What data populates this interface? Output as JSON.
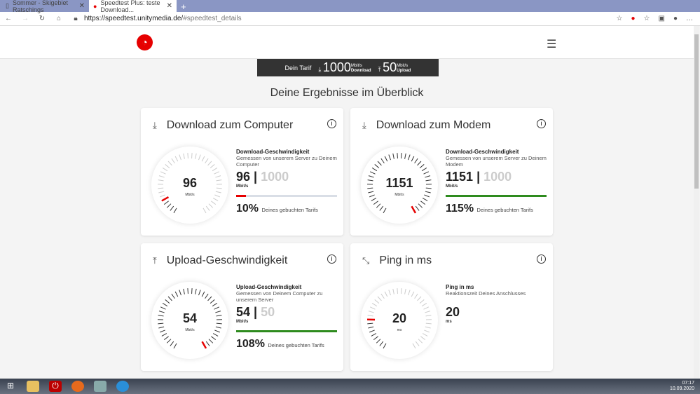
{
  "browser": {
    "tabs": [
      {
        "label": "Sommer - Skigebiet Ratschings"
      },
      {
        "label": "Speedtest Plus: teste Download..."
      }
    ],
    "url_domain": "https://speedtest.unitymedia.de/",
    "url_rest": "#speedtest_details"
  },
  "tarif": {
    "label": "Dein Tarif",
    "download": "1000",
    "download_unit": "Mbit/s",
    "download_label": "Download",
    "upload": "50",
    "upload_unit": "Mbit/s",
    "upload_label": "Upload"
  },
  "title": "Deine Ergebnisse im Überblick",
  "cards": [
    {
      "heading": "Download zum Computer",
      "value": "96",
      "unit": "Mbit/s",
      "label": "Download-Geschwindigkeit",
      "desc": "Gemessen von unserem Server zu Deinem Computer",
      "of": "1000",
      "sep": "|",
      "pct": "10%",
      "pct_text": "Deines gebuchten Tarifs",
      "fraction": 0.096,
      "bar_color": "#e60000"
    },
    {
      "heading": "Download zum Modem",
      "value": "1151",
      "unit": "Mbit/s",
      "label": "Download-Geschwindigkeit",
      "desc": "Gemessen von unserem Server zu Deinem Modem",
      "of": "1000",
      "sep": "|",
      "pct": "115%",
      "pct_text": "Deines gebuchten Tarifs",
      "fraction": 1.0,
      "bar_color": "#2e8b1e"
    },
    {
      "heading": "Upload-Geschwindigkeit",
      "value": "54",
      "unit": "Mbit/s",
      "label": "Upload-Geschwindigkeit",
      "desc": "Gemessen von Deinem Computer zu unserem Server",
      "of": "50",
      "sep": "|",
      "pct": "108%",
      "pct_text": "Deines gebuchten Tarifs",
      "fraction": 1.0,
      "bar_color": "#2e8b1e"
    },
    {
      "heading": "Ping in ms",
      "value": "20",
      "unit": "ms",
      "label": "Ping in ms",
      "desc": "Reaktionszeit Deines Anschlusses",
      "fraction": 0.2
    }
  ],
  "tray": {
    "time": "07:17",
    "date": "10.09.2020"
  }
}
